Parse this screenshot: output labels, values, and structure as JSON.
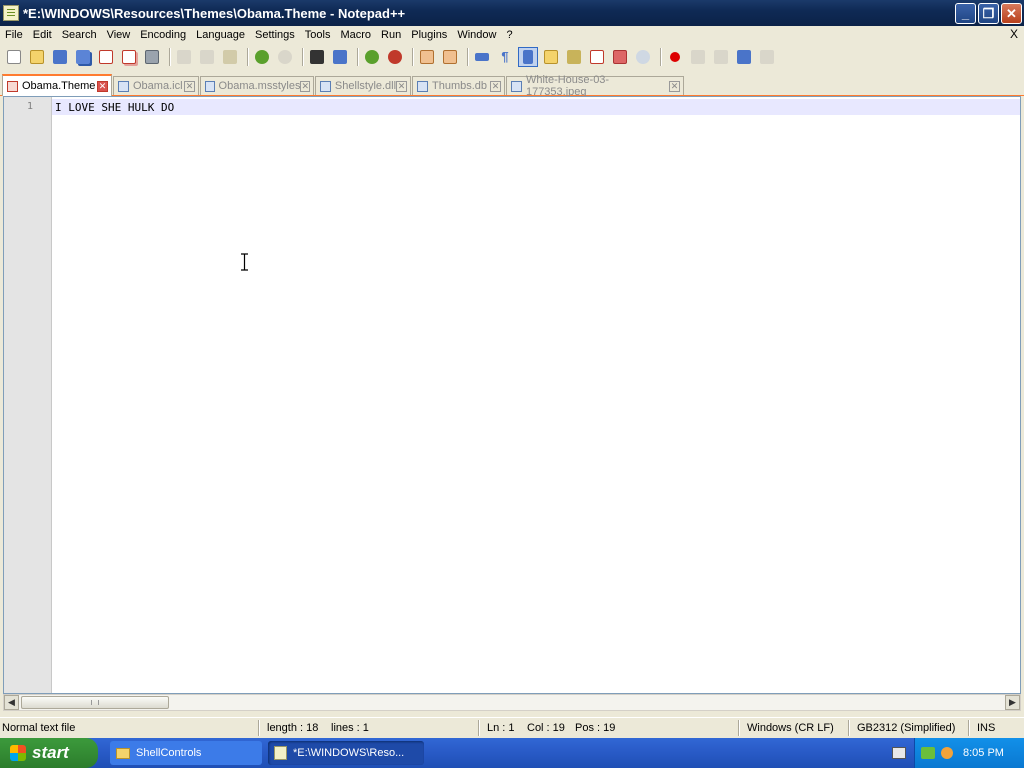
{
  "window": {
    "title": "*E:\\WINDOWS\\Resources\\Themes\\Obama.Theme - Notepad++",
    "controls": {
      "minimize": "_",
      "restore": "❐",
      "close": "✕"
    }
  },
  "menu": {
    "items": [
      "File",
      "Edit",
      "Search",
      "View",
      "Encoding",
      "Language",
      "Settings",
      "Tools",
      "Macro",
      "Run",
      "Plugins",
      "Window",
      "?"
    ],
    "close_glyph": "X"
  },
  "toolbar": {
    "icons": [
      "new-icon",
      "open-icon",
      "save-icon",
      "save-all-icon",
      "close-icon",
      "close-all-icon",
      "print-icon",
      "cut-icon",
      "copy-icon",
      "paste-icon",
      "undo-icon",
      "redo-icon",
      "find-icon",
      "replace-icon",
      "zoom-in-icon",
      "zoom-out-icon",
      "sync-v-icon",
      "sync-h-icon",
      "wrap-icon",
      "show-all-chars-icon",
      "indent-guide-icon",
      "udl-icon",
      "doc-map-icon",
      "function-list-icon",
      "monitor-icon",
      "record-icon",
      "stop-icon",
      "play-icon",
      "play-multi-icon",
      "save-macro-icon"
    ]
  },
  "tabs": [
    {
      "label": "Obama.Theme",
      "active": true
    },
    {
      "label": "Obama.icl",
      "active": false
    },
    {
      "label": "Obama.msstyles",
      "active": false
    },
    {
      "label": "Shellstyle.dll",
      "active": false
    },
    {
      "label": "Thumbs.db",
      "active": false
    },
    {
      "label": "White-House-03-177353.jpeg",
      "active": false
    }
  ],
  "editor": {
    "line_number": "1",
    "text": "I LOVE SHE HULK DO"
  },
  "scrollbar": {
    "left_arrow": "◀",
    "right_arrow": "▶"
  },
  "status": {
    "file_type": "Normal text file",
    "length": "length : 18",
    "lines": "lines : 1",
    "ln": "Ln : 1",
    "col": "Col : 19",
    "pos": "Pos : 19",
    "eol": "Windows (CR LF)",
    "encoding": "GB2312 (Simplified)",
    "mode": "INS"
  },
  "taskbar": {
    "start": "start",
    "tasks": [
      {
        "label": "ShellControls",
        "active": false
      },
      {
        "label": "*E:\\WINDOWS\\Reso...",
        "active": true
      }
    ],
    "clock": "8:05 PM"
  },
  "colors": {
    "tab_accent": "#ff7b2f",
    "caret_line": "#e8e8ff",
    "title_bar": "#0f2a55",
    "taskbar": "#2a5cc9",
    "start_button": "#3c9a3c"
  }
}
